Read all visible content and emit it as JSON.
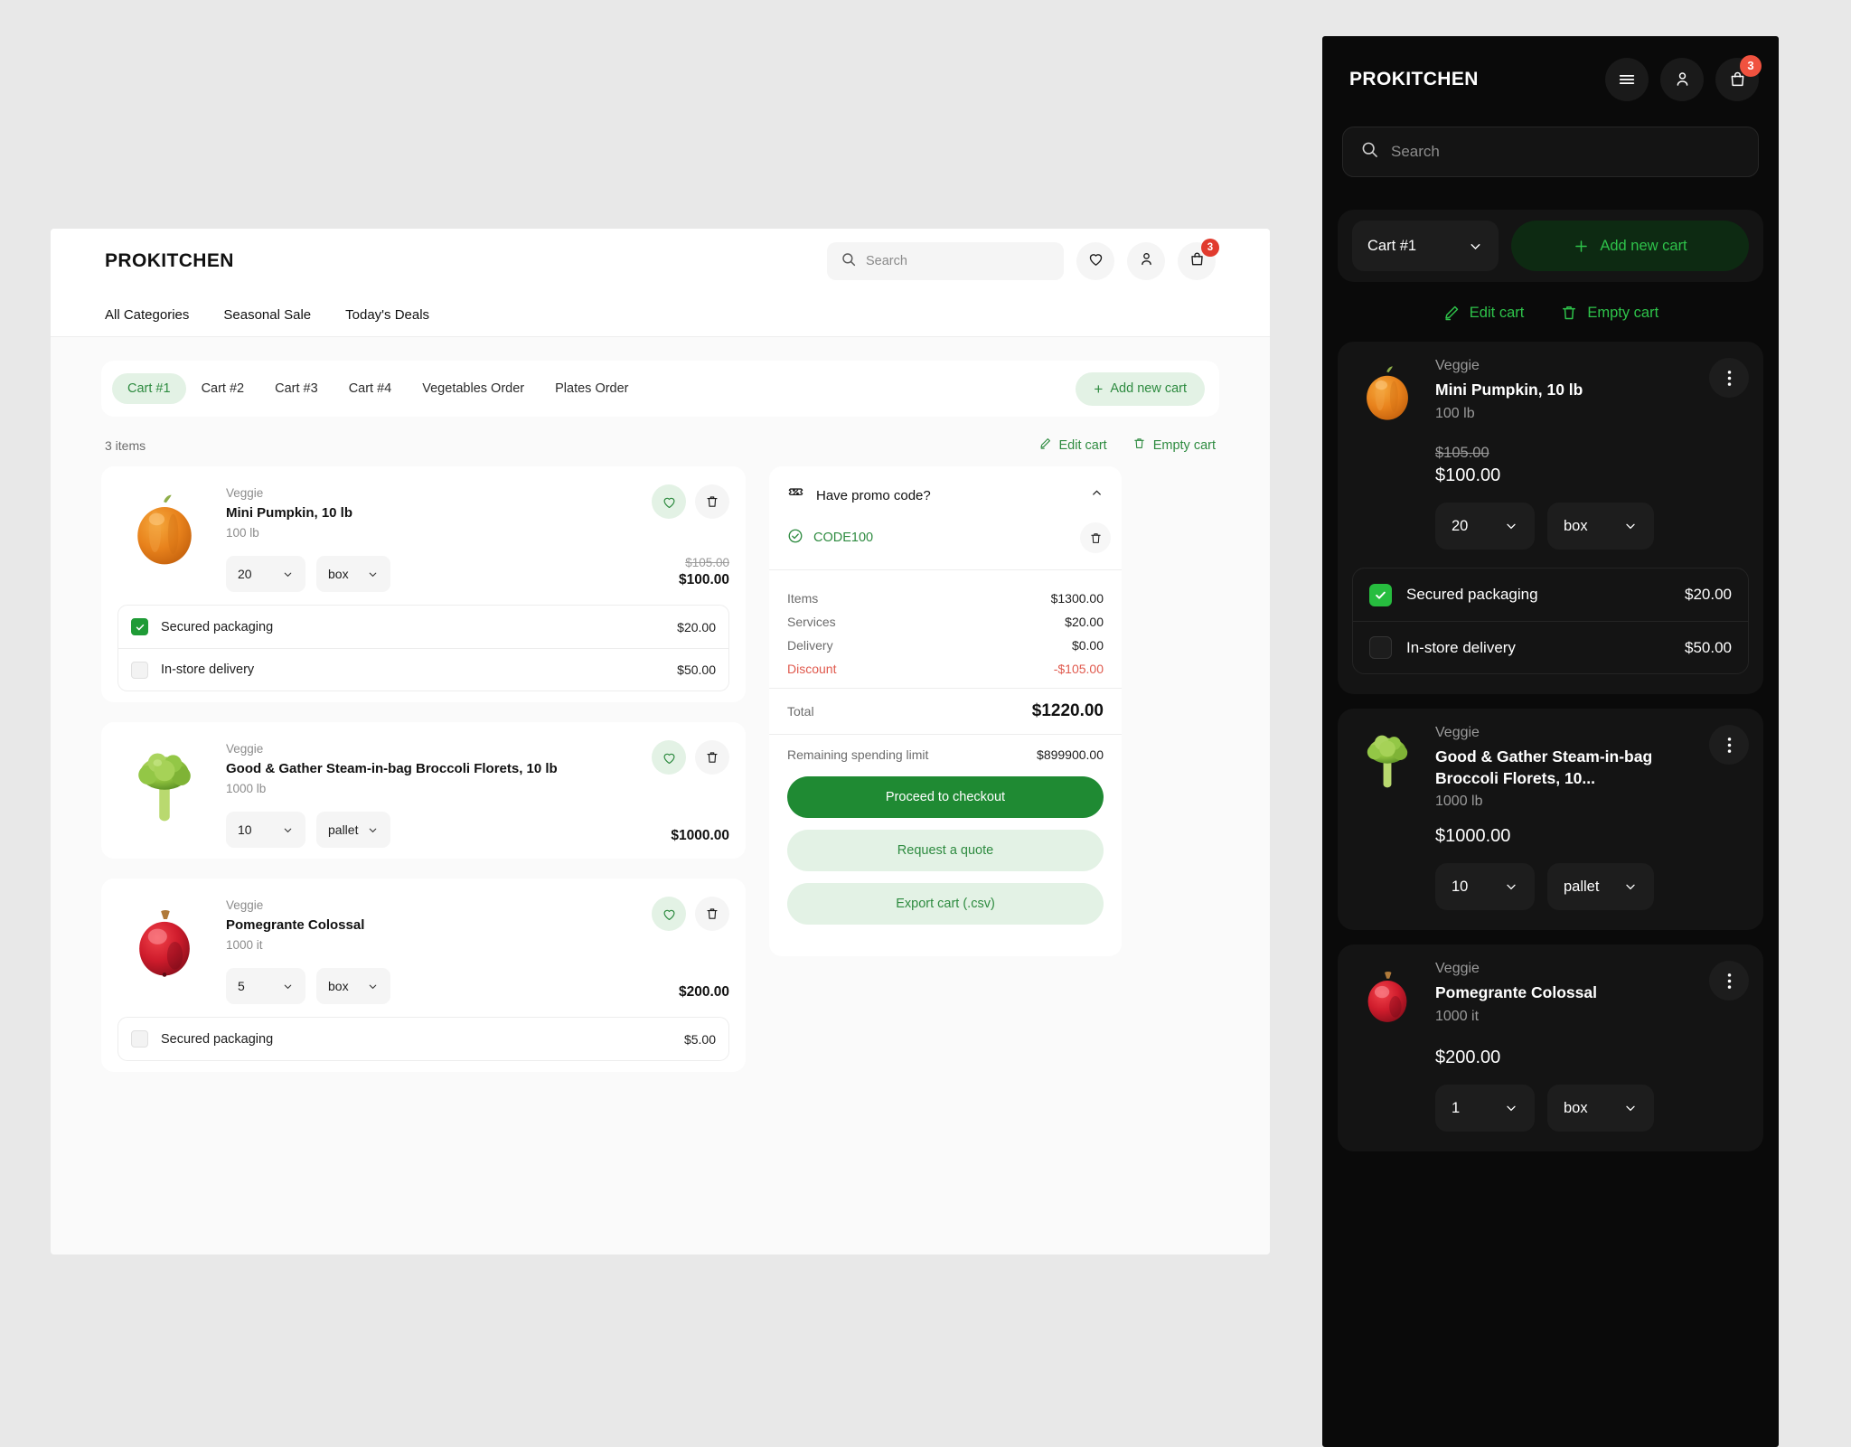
{
  "desktop": {
    "brand": "PROKITCHEN",
    "search": {
      "placeholder": "Search"
    },
    "header_icons": {
      "search": "search-icon",
      "favorite": "heart-icon",
      "account": "user-icon",
      "cart": "bag-icon",
      "cart_badge": "3"
    },
    "nav": [
      {
        "label": "All Categories"
      },
      {
        "label": "Seasonal Sale"
      },
      {
        "label": "Today's Deals"
      }
    ],
    "cart_tabs": [
      {
        "label": "Cart #1",
        "active": true
      },
      {
        "label": "Cart #2",
        "active": false
      },
      {
        "label": "Cart #3",
        "active": false
      },
      {
        "label": "Cart #4",
        "active": false
      },
      {
        "label": "Vegetables Order",
        "active": false
      },
      {
        "label": "Plates Order",
        "active": false
      }
    ],
    "add_new_cart": "Add new cart",
    "items_count": "3 items",
    "edit_cart": "Edit cart",
    "empty_cart": "Empty cart",
    "products": [
      {
        "category": "Veggie",
        "title": "Mini Pumpkin, 10 lb",
        "subtitle": "100 lb",
        "qty": "20",
        "unit": "box",
        "price_old": "$105.00",
        "price": "$100.00",
        "image": "pumpkin",
        "options": [
          {
            "label": "Secured packaging",
            "price": "$20.00",
            "checked": true
          },
          {
            "label": "In-store delivery",
            "price": "$50.00",
            "checked": false
          }
        ]
      },
      {
        "category": "Veggie",
        "title": "Good & Gather Steam-in-bag Broccoli Florets, 10 lb",
        "subtitle": "1000 lb",
        "qty": "10",
        "unit": "pallet",
        "price_old": "",
        "price": "$1000.00",
        "image": "broccoli",
        "options": []
      },
      {
        "category": "Veggie",
        "title": "Pomegrante Colossal",
        "subtitle": "1000 it",
        "qty": "5",
        "unit": "box",
        "price_old": "",
        "price": "$200.00",
        "image": "pomegranate",
        "options": [
          {
            "label": "Secured packaging",
            "price": "$5.00",
            "checked": false
          }
        ]
      }
    ],
    "summary": {
      "promo_title": "Have promo code?",
      "promo_code": "CODE100",
      "lines": [
        {
          "label": "Items",
          "value": "$1300.00",
          "negative": false
        },
        {
          "label": "Services",
          "value": "$20.00",
          "negative": false
        },
        {
          "label": "Delivery",
          "value": "$0.00",
          "negative": false
        },
        {
          "label": "Discount",
          "value": "-$105.00",
          "negative": true
        }
      ],
      "total_label": "Total",
      "total_value": "$1220.00",
      "limit_label": "Remaining spending limit",
      "limit_value": "$899900.00",
      "btn_checkout": "Proceed to checkout",
      "btn_quote": "Request a quote",
      "btn_export": "Export cart (.csv)"
    }
  },
  "mobile": {
    "brand": "PROKITCHEN",
    "search": {
      "placeholder": "Search"
    },
    "cart_badge": "3",
    "cart_selected": "Cart #1",
    "add_new_cart": "Add new cart",
    "edit_cart": "Edit cart",
    "empty_cart": "Empty cart",
    "products": [
      {
        "category": "Veggie",
        "title": "Mini Pumpkin, 10 lb",
        "subtitle": "100 lb",
        "price_old": "$105.00",
        "price": "$100.00",
        "qty": "20",
        "unit": "box",
        "image": "pumpkin",
        "options": [
          {
            "label": "Secured packaging",
            "price": "$20.00",
            "checked": true
          },
          {
            "label": "In-store delivery",
            "price": "$50.00",
            "checked": false
          }
        ]
      },
      {
        "category": "Veggie",
        "title": "Good & Gather Steam-in-bag Broccoli Florets, 10...",
        "subtitle": "1000 lb",
        "price_old": "",
        "price": "$1000.00",
        "qty": "10",
        "unit": "pallet",
        "image": "broccoli",
        "options": []
      },
      {
        "category": "Veggie",
        "title": "Pomegrante Colossal",
        "subtitle": "1000 it",
        "price_old": "",
        "price": "$200.00",
        "qty": "1",
        "unit": "box",
        "image": "pomegranate",
        "options": []
      }
    ]
  },
  "colors": {
    "accent_green": "#2e8b40",
    "accent_green_light": "#e3f2e5",
    "primary_btn": "#1f8a33",
    "mobile_green": "#2ec24a",
    "danger": "#e05a4e",
    "badge_red": "#e13b2e",
    "check_green": "#1f9b36"
  }
}
